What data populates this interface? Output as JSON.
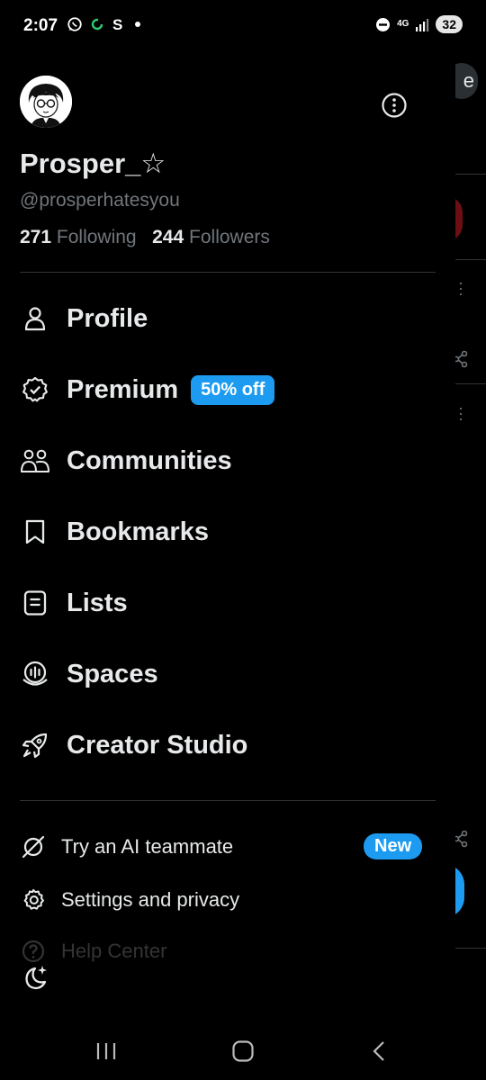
{
  "status_bar": {
    "time": "2:07",
    "network": "4G",
    "battery": "32",
    "icons": [
      "whatsapp-icon",
      "sync-icon",
      "s-app-icon",
      "dot-icon",
      "dnd-icon",
      "signal-icon",
      "battery-icon"
    ]
  },
  "profile": {
    "display_name": "Prosper_☆",
    "handle": "@prosperhatesyou",
    "following_count": "271",
    "following_label": "Following",
    "followers_count": "244",
    "followers_label": "Followers"
  },
  "menu": {
    "profile": "Profile",
    "premium": "Premium",
    "premium_badge": "50% off",
    "communities": "Communities",
    "bookmarks": "Bookmarks",
    "lists": "Lists",
    "spaces": "Spaces",
    "creator_studio": "Creator Studio"
  },
  "secondary": {
    "ai_teammate": "Try an AI teammate",
    "new_badge": "New",
    "settings": "Settings and privacy",
    "help_center": "Help Center"
  },
  "background": {
    "pill_text": "e"
  },
  "colors": {
    "accent": "#1d9bf0",
    "text": "#e7e9ea",
    "muted": "#71767b",
    "divider": "#2f3336",
    "background": "#000000"
  }
}
